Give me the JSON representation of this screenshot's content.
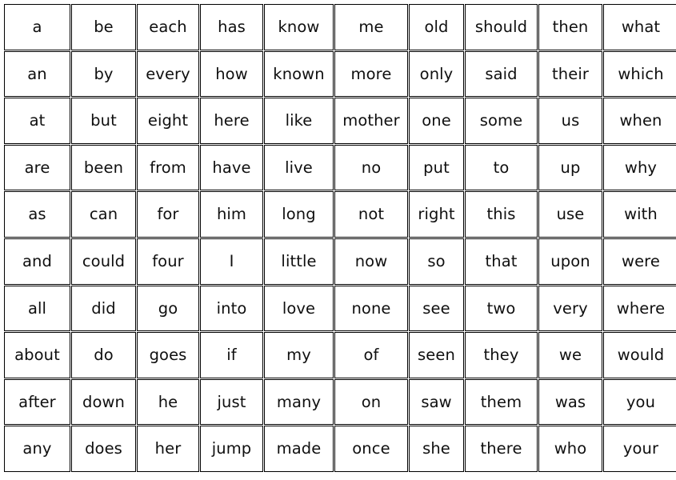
{
  "document": {
    "kind": "sight-word-grid",
    "rows": 10,
    "columns": 10,
    "text_color": "#0f0f0f",
    "border_color": "#000000",
    "background_color": "#ffffff"
  },
  "grid": {
    "rows": [
      [
        "a",
        "be",
        "each",
        "has",
        "know",
        "me",
        "old",
        "should",
        "then",
        "what"
      ],
      [
        "an",
        "by",
        "every",
        "how",
        "known",
        "more",
        "only",
        "said",
        "their",
        "which"
      ],
      [
        "at",
        "but",
        "eight",
        "here",
        "like",
        "mother",
        "one",
        "some",
        "us",
        "when"
      ],
      [
        "are",
        "been",
        "from",
        "have",
        "live",
        "no",
        "put",
        "to",
        "up",
        "why"
      ],
      [
        "as",
        "can",
        "for",
        "him",
        "long",
        "not",
        "right",
        "this",
        "use",
        "with"
      ],
      [
        "and",
        "could",
        "four",
        "I",
        "little",
        "now",
        "so",
        "that",
        "upon",
        "were"
      ],
      [
        "all",
        "did",
        "go",
        "into",
        "love",
        "none",
        "see",
        "two",
        "very",
        "where"
      ],
      [
        "about",
        "do",
        "goes",
        "if",
        "my",
        "of",
        "seen",
        "they",
        "we",
        "would"
      ],
      [
        "after",
        "down",
        "he",
        "just",
        "many",
        "on",
        "saw",
        "them",
        "was",
        "you"
      ],
      [
        "any",
        "does",
        "her",
        "jump",
        "made",
        "once",
        "she",
        "there",
        "who",
        "your"
      ]
    ]
  }
}
